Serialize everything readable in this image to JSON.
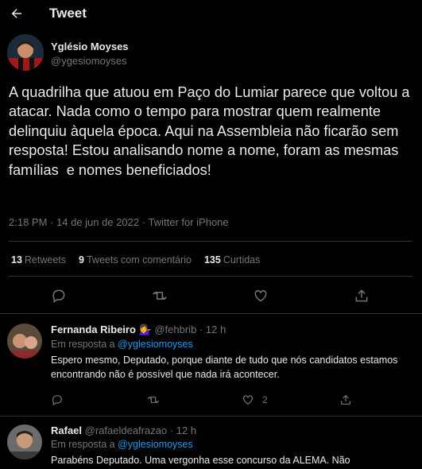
{
  "header": {
    "title": "Tweet",
    "back_icon": "arrow-left-icon"
  },
  "author": {
    "name": "Yglésio Moyses",
    "handle": "@ygesiomoyses"
  },
  "tweet": {
    "text": "A quadrilha que atuou em Paço do Lumiar parece que voltou a atacar. Nada como o tempo para mostrar quem realmente delinquiu àquela época. Aqui na Assembleia não ficarão sem resposta! Estou analisando nome a nome, foram as mesmas famílias  e nomes beneficiados!",
    "time": "2:18 PM",
    "date": "14 de jun de 2022",
    "source": "Twitter for iPhone",
    "sep": "·"
  },
  "stats": {
    "retweets_count": "13",
    "retweets_label": "Retweets",
    "quotes_count": "9",
    "quotes_label": "Tweets com comentário",
    "likes_count": "135",
    "likes_label": "Curtidas"
  },
  "replies": [
    {
      "name": "Fernanda Ribeiro",
      "emoji": "💁‍♀️",
      "handle": "@fehbrib",
      "time": "12 h",
      "context_prefix": "Em resposta a ",
      "context_handle": "@yglesiomoyses",
      "text": "Espero mesmo, Deputado, porque diante de tudo que nós candidatos estamos encontrando não é possível que nada irá acontecer.",
      "like_count": "2"
    },
    {
      "name": "Rafael",
      "handle": "@rafaeldeafrazao",
      "time": "12 h",
      "context_prefix": "Em resposta a ",
      "context_handle": "@yglesiomoyses",
      "text": "Parabéns Deputado. Uma vergonha esse concurso da ALEMA. Não"
    }
  ],
  "colors": {
    "background": "#000000",
    "accent": "#1d9bf0",
    "muted": "#71767b",
    "border": "#2f3336"
  }
}
